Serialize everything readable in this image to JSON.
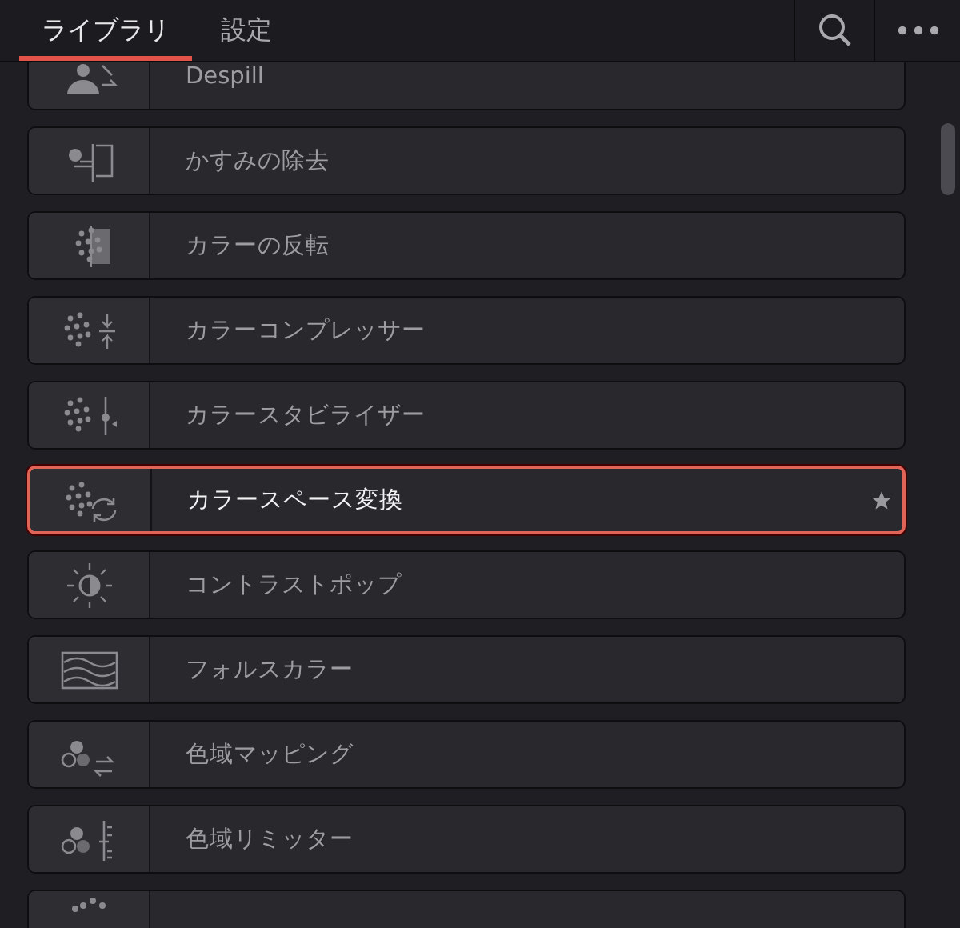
{
  "tabs": [
    {
      "label": "ライブラリ",
      "selected": true
    },
    {
      "label": "設定",
      "selected": false
    }
  ],
  "effects": [
    {
      "label": "Despill",
      "selected": false,
      "favorite": false
    },
    {
      "label": "かすみの除去",
      "selected": false,
      "favorite": false
    },
    {
      "label": "カラーの反転",
      "selected": false,
      "favorite": false
    },
    {
      "label": "カラーコンプレッサー",
      "selected": false,
      "favorite": false
    },
    {
      "label": "カラースタビライザー",
      "selected": false,
      "favorite": false
    },
    {
      "label": "カラースペース変換",
      "selected": true,
      "favorite": true
    },
    {
      "label": "コントラストポップ",
      "selected": false,
      "favorite": false
    },
    {
      "label": "フォルスカラー",
      "selected": false,
      "favorite": false
    },
    {
      "label": "色域マッピング",
      "selected": false,
      "favorite": false
    },
    {
      "label": "色域リミッター",
      "selected": false,
      "favorite": false
    },
    {
      "selected": false,
      "favorite": false
    }
  ]
}
